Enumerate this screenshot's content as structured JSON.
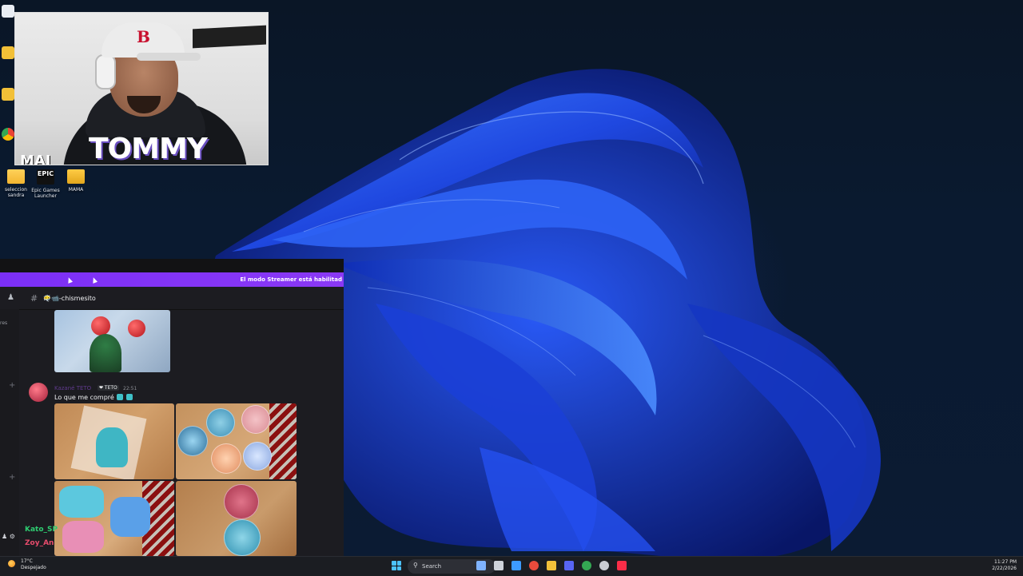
{
  "desktop": {
    "icons": [
      {
        "label": "seleccion sandra",
        "type": "folder"
      },
      {
        "label": "Epic Games Launcher",
        "type": "epic",
        "glyph_text": "EPIC"
      },
      {
        "label": "MAMA",
        "type": "folder"
      }
    ]
  },
  "webcam": {
    "shirt_text": "TOMMY",
    "overlay_tag": "MAI",
    "cap_logo": "B"
  },
  "discord": {
    "streamer_banner": "El modo Streamer está habilitad",
    "channel_name": "😶‍🌫️📹-chismesito",
    "rail_label": "res",
    "message": {
      "author": "Kazané TETO",
      "badge": "❤ TETO",
      "time": "22:51",
      "text": "Lo que me compré"
    },
    "bottom_users": [
      {
        "name": "Kato_SP",
        "color": "#2ecc71"
      },
      {
        "name": "Zoy_An",
        "color": "#e74c6c"
      }
    ]
  },
  "taskbar": {
    "weather_temp": "17°C",
    "weather_desc": "Despejado",
    "search_placeholder": "Search",
    "time": "11:27 PM",
    "date": "2/22/2026",
    "pinned_apps": [
      {
        "name": "widgets-icon",
        "color": "#7fb3ff"
      },
      {
        "name": "task-view-icon",
        "color": "#cfd3da"
      },
      {
        "name": "mail-icon",
        "color": "#3d9bff"
      },
      {
        "name": "chrome-icon",
        "color": "#e94b3c"
      },
      {
        "name": "file-explorer-icon",
        "color": "#f3c13a"
      },
      {
        "name": "discord-icon",
        "color": "#5865f2"
      },
      {
        "name": "browser-icon",
        "color": "#34a853"
      },
      {
        "name": "settings-icon",
        "color": "#c9ccd3"
      },
      {
        "name": "music-icon",
        "color": "#fa2d48"
      }
    ]
  }
}
